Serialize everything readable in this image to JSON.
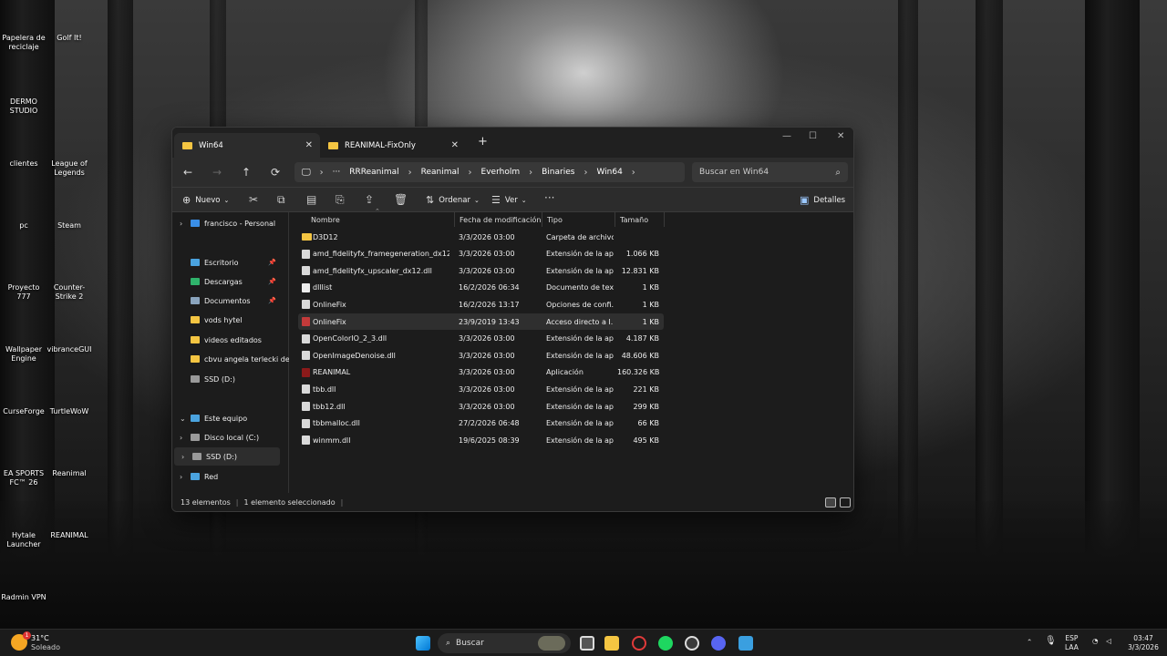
{
  "desktop": {
    "icons": [
      {
        "label": "Papelera de reciclaje",
        "icon": "recycle-bin-icon",
        "color": "#dfe7ee"
      },
      {
        "label": "Golf It!",
        "icon": "golf-it-icon",
        "color": "#5a8f3a"
      },
      {
        "label": "DERMO STUDIO",
        "icon": "folder-icon",
        "color": "#e8b84a"
      },
      {
        "label": "clientes",
        "icon": "folder-icon",
        "color": "#e8b84a"
      },
      {
        "label": "League of Legends",
        "icon": "league-of-legends-icon",
        "color": "#c8a13c"
      },
      {
        "label": "pc",
        "icon": "folder-icon",
        "color": "#f0c84c"
      },
      {
        "label": "Steam",
        "icon": "steam-icon",
        "color": "#1b2838"
      },
      {
        "label": "Proyecto 777",
        "icon": "folder-icon",
        "color": "#e8b84a"
      },
      {
        "label": "Counter-Strike 2",
        "icon": "counter-strike-icon",
        "color": "#2b5ea8"
      },
      {
        "label": "Wallpaper Engine",
        "icon": "wallpaper-engine-icon",
        "color": "#2a6fd6"
      },
      {
        "label": "vibranceGUI",
        "icon": "vibrance-gui-icon",
        "color": "#3c7bd4"
      },
      {
        "label": "CurseForge",
        "icon": "curseforge-icon",
        "color": "#f16436"
      },
      {
        "label": "TurtleWoW",
        "icon": "turtlewow-icon",
        "color": "#6b3aa0"
      },
      {
        "label": "EA SPORTS FC™ 26",
        "icon": "ea-sports-fc-icon",
        "color": "#111111"
      },
      {
        "label": "Reanimal",
        "icon": "reanimal-icon",
        "color": "#2a2a2a"
      },
      {
        "label": "Hytale Launcher",
        "icon": "hytale-icon",
        "color": "#3a5fa0"
      },
      {
        "label": "REANIMAL",
        "icon": "reanimal-icon",
        "color": "#2a2a2a"
      },
      {
        "label": "Radmin VPN",
        "icon": "radmin-vpn-icon",
        "color": "#1fb3c9"
      }
    ]
  },
  "window": {
    "tabs": [
      {
        "label": "Win64",
        "active": true
      },
      {
        "label": "REANIMAL-FixOnly",
        "active": false
      }
    ],
    "new_tab": "+",
    "controls": {
      "minimize": "—",
      "maximize": "☐",
      "close": "✕"
    },
    "nav": {
      "back": "←",
      "forward": "→",
      "up": "↑",
      "refresh": "⟳"
    },
    "breadcrumbs": [
      "RRReanimal",
      "Reanimal",
      "Everholm",
      "Binaries",
      "Win64"
    ],
    "breadcrumb_more": "···",
    "search": {
      "placeholder": "Buscar en Win64"
    },
    "toolbar": {
      "new_label": "Nuevo",
      "sort_label": "Ordenar",
      "view_label": "Ver",
      "more": "···",
      "details_label": "Detalles"
    },
    "sidebar": {
      "items": [
        {
          "label": "francisco - Personal",
          "icon": "onedrive-icon",
          "color": "#3a8ee6",
          "chevron": "›",
          "pinned": false
        },
        {
          "label": "Escritorio",
          "icon": "desktop-folder-icon",
          "color": "#4aa3df",
          "chevron": "",
          "pinned": true
        },
        {
          "label": "Descargas",
          "icon": "download-icon",
          "color": "#2fb36b",
          "chevron": "",
          "pinned": true
        },
        {
          "label": "Documentos",
          "icon": "documents-icon",
          "color": "#8aa4bd",
          "chevron": "",
          "pinned": true
        },
        {
          "label": "vods hytel",
          "icon": "folder-icon",
          "color": "#f4c542",
          "chevron": "",
          "pinned": false
        },
        {
          "label": "videos editados",
          "icon": "folder-icon",
          "color": "#f4c542",
          "chevron": "",
          "pinned": false
        },
        {
          "label": "cbvu angela terlecki de",
          "icon": "folder-icon",
          "color": "#f4c542",
          "chevron": "",
          "pinned": false
        },
        {
          "label": "SSD (D:)",
          "icon": "drive-icon",
          "color": "#9a9a9a",
          "chevron": "",
          "pinned": false
        },
        {
          "label": "Este equipo",
          "icon": "computer-icon",
          "color": "#4aa3df",
          "chevron": "⌄",
          "pinned": false
        },
        {
          "label": "Disco local (C:)",
          "icon": "drive-icon",
          "color": "#9a9a9a",
          "chevron": "›",
          "pinned": false
        },
        {
          "label": "SSD (D:)",
          "icon": "drive-icon",
          "color": "#9a9a9a",
          "chevron": "›",
          "pinned": false
        },
        {
          "label": "Red",
          "icon": "network-icon",
          "color": "#4aa3df",
          "chevron": "›",
          "pinned": false
        }
      ]
    },
    "columns": [
      "Nombre",
      "Fecha de modificación",
      "Tipo",
      "Tamaño"
    ],
    "files": [
      {
        "name": "D3D12",
        "date": "3/3/2026 03:00",
        "type": "Carpeta de archivos",
        "size": "",
        "icon": "folder-icon",
        "color": "#f4c542"
      },
      {
        "name": "amd_fidelityfx_framegeneration_dx12.dll",
        "date": "3/3/2026 03:00",
        "type": "Extensión de la apl...",
        "size": "1.066 KB",
        "icon": "dll-file-icon",
        "color": "#d9d9d9"
      },
      {
        "name": "amd_fidelityfx_upscaler_dx12.dll",
        "date": "3/3/2026 03:00",
        "type": "Extensión de la apl...",
        "size": "12.831 KB",
        "icon": "dll-file-icon",
        "color": "#d9d9d9"
      },
      {
        "name": "dlllist",
        "date": "16/2/2026 06:34",
        "type": "Documento de tex...",
        "size": "1 KB",
        "icon": "text-file-icon",
        "color": "#ececec"
      },
      {
        "name": "OnlineFix",
        "date": "16/2/2026 13:17",
        "type": "Opciones de confi...",
        "size": "1 KB",
        "icon": "config-file-icon",
        "color": "#d9d9d9"
      },
      {
        "name": "OnlineFix",
        "date": "23/9/2019 13:43",
        "type": "Acceso directo a I...",
        "size": "1 KB",
        "icon": "shortcut-icon",
        "color": "#c23a3a"
      },
      {
        "name": "OpenColorIO_2_3.dll",
        "date": "3/3/2026 03:00",
        "type": "Extensión de la apl...",
        "size": "4.187 KB",
        "icon": "dll-file-icon",
        "color": "#d9d9d9"
      },
      {
        "name": "OpenImageDenoise.dll",
        "date": "3/3/2026 03:00",
        "type": "Extensión de la apl...",
        "size": "48.606 KB",
        "icon": "dll-file-icon",
        "color": "#d9d9d9"
      },
      {
        "name": "REANIMAL",
        "date": "3/3/2026 03:00",
        "type": "Aplicación",
        "size": "160.326 KB",
        "icon": "reanimal-app-icon",
        "color": "#8b1a1a"
      },
      {
        "name": "tbb.dll",
        "date": "3/3/2026 03:00",
        "type": "Extensión de la apl...",
        "size": "221 KB",
        "icon": "dll-file-icon",
        "color": "#d9d9d9"
      },
      {
        "name": "tbb12.dll",
        "date": "3/3/2026 03:00",
        "type": "Extensión de la apl...",
        "size": "299 KB",
        "icon": "dll-file-icon",
        "color": "#d9d9d9"
      },
      {
        "name": "tbbmalloc.dll",
        "date": "27/2/2026 06:48",
        "type": "Extensión de la apl...",
        "size": "66 KB",
        "icon": "dll-file-icon",
        "color": "#d9d9d9"
      },
      {
        "name": "winmm.dll",
        "date": "19/6/2025 08:39",
        "type": "Extensión de la apl...",
        "size": "495 KB",
        "icon": "dll-file-icon",
        "color": "#d9d9d9"
      }
    ],
    "selected_index": 5,
    "status": {
      "count": "13 elementos",
      "selection": "1 elemento seleccionado"
    }
  },
  "taskbar": {
    "weather": {
      "temp": "31°C",
      "condition": "Soleado",
      "badge": "1"
    },
    "search_label": "Buscar",
    "language": {
      "line1": "ESP",
      "line2": "LAA"
    },
    "clock": {
      "time": "03:47",
      "date": "3/3/2026"
    },
    "chevron": "⌃"
  },
  "colors": {
    "accent": "#4cc2ff",
    "folder": "#f4c542"
  }
}
